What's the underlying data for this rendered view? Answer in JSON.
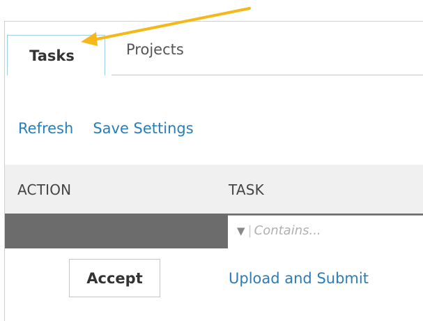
{
  "tabs": [
    {
      "label": "Tasks",
      "active": true
    },
    {
      "label": "Projects",
      "active": false
    }
  ],
  "toolbar": {
    "refresh_label": "Refresh",
    "save_settings_label": "Save Settings"
  },
  "table": {
    "columns": [
      "ACTION",
      "TASK"
    ],
    "filter": {
      "placeholder": "Contains..."
    },
    "rows": [
      {
        "action_label": "Accept",
        "task": "Upload and Submit"
      }
    ]
  },
  "annotation": {
    "color": "#f5b818"
  },
  "colors": {
    "link": "#2a7db8",
    "tab_border": "#9fd0e8",
    "filter_bar": "#6c6c6c",
    "header_bg": "#f0f0f0"
  }
}
